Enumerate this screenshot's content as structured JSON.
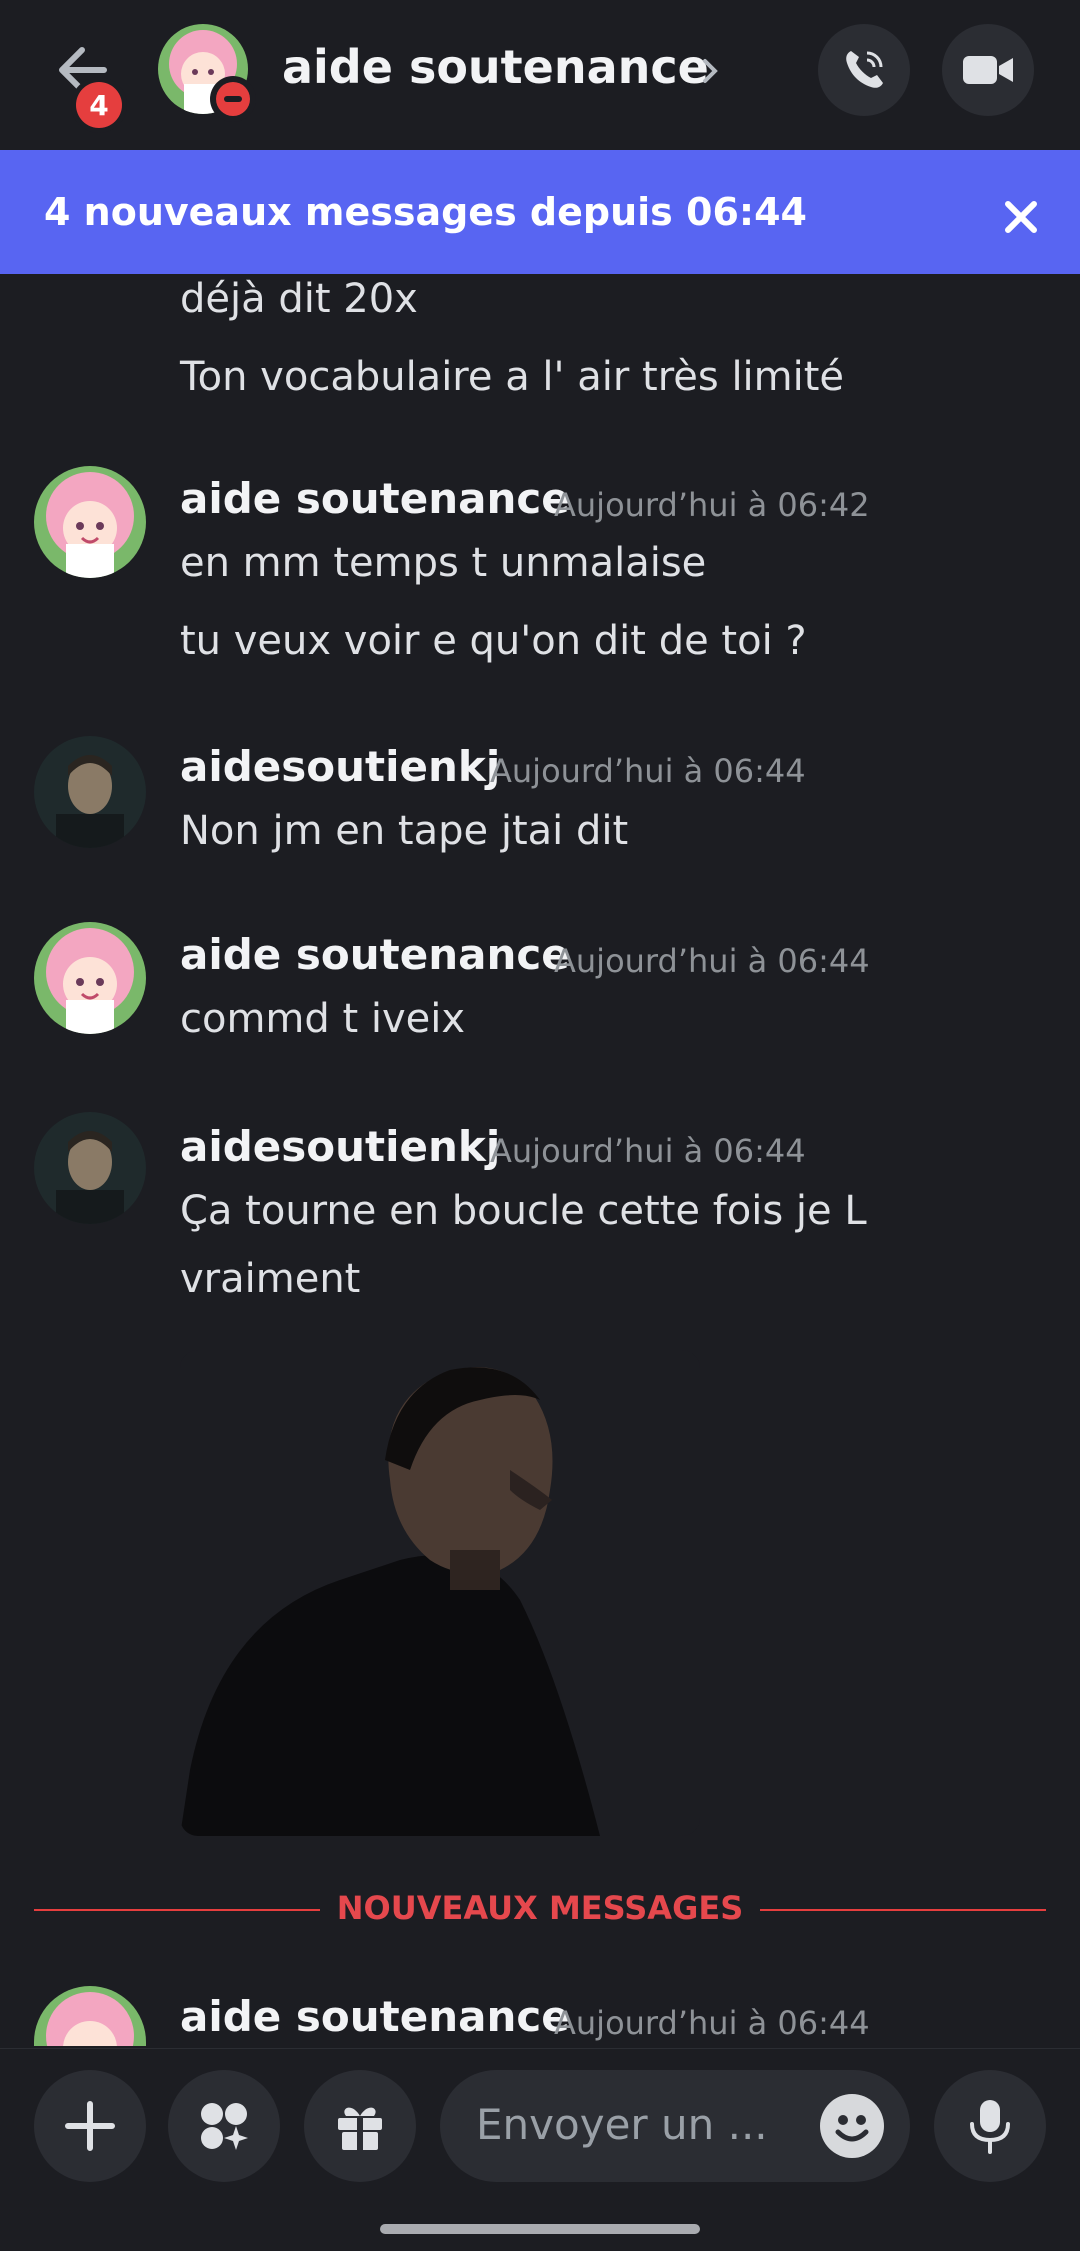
{
  "header": {
    "title": "aide soutenance",
    "unread_count": "4"
  },
  "banner": {
    "text": "4 nouveaux messages depuis 06:44"
  },
  "messages": {
    "m0_line1": "déjà dit 20x",
    "m0_line2": "Ton vocabulaire a l' air très limité",
    "m1": {
      "author": "aide soutenance",
      "time": "Aujourd’hui à 06:42",
      "line1": "en mm temps t unmalaise",
      "line2": "tu veux voir e qu'on dit de toi ?"
    },
    "m2": {
      "author": "aidesoutienkj",
      "time": "Aujourd’hui à 06:44",
      "line1": "Non jm en tape jtai dit"
    },
    "m3": {
      "author": "aide soutenance",
      "time": "Aujourd’hui à 06:44",
      "line1": "commd t iveix"
    },
    "m4": {
      "author": "aidesoutienkj",
      "time": "Aujourd’hui à 06:44",
      "line1": "Ça tourne en boucle cette fois je L",
      "line2": "vraiment"
    },
    "new_divider": "NOUVEAUX MESSAGES",
    "m5": {
      "author": "aide soutenance",
      "time": "Aujourd’hui à 06:44"
    }
  },
  "composer": {
    "placeholder": "Envoyer un ..."
  },
  "colors": {
    "background": "#1c1d22",
    "banner": "#5865f2",
    "new_divider": "#e53e3e",
    "dnd_status": "#e53e3e"
  },
  "icons": {
    "back": "arrow-left-icon",
    "call": "phone-icon",
    "video": "video-camera-icon",
    "close": "x-icon",
    "add": "plus-icon",
    "apps": "sparkle-apps-icon",
    "gift": "gift-icon",
    "emoji": "smiley-icon",
    "mic": "microphone-icon"
  }
}
